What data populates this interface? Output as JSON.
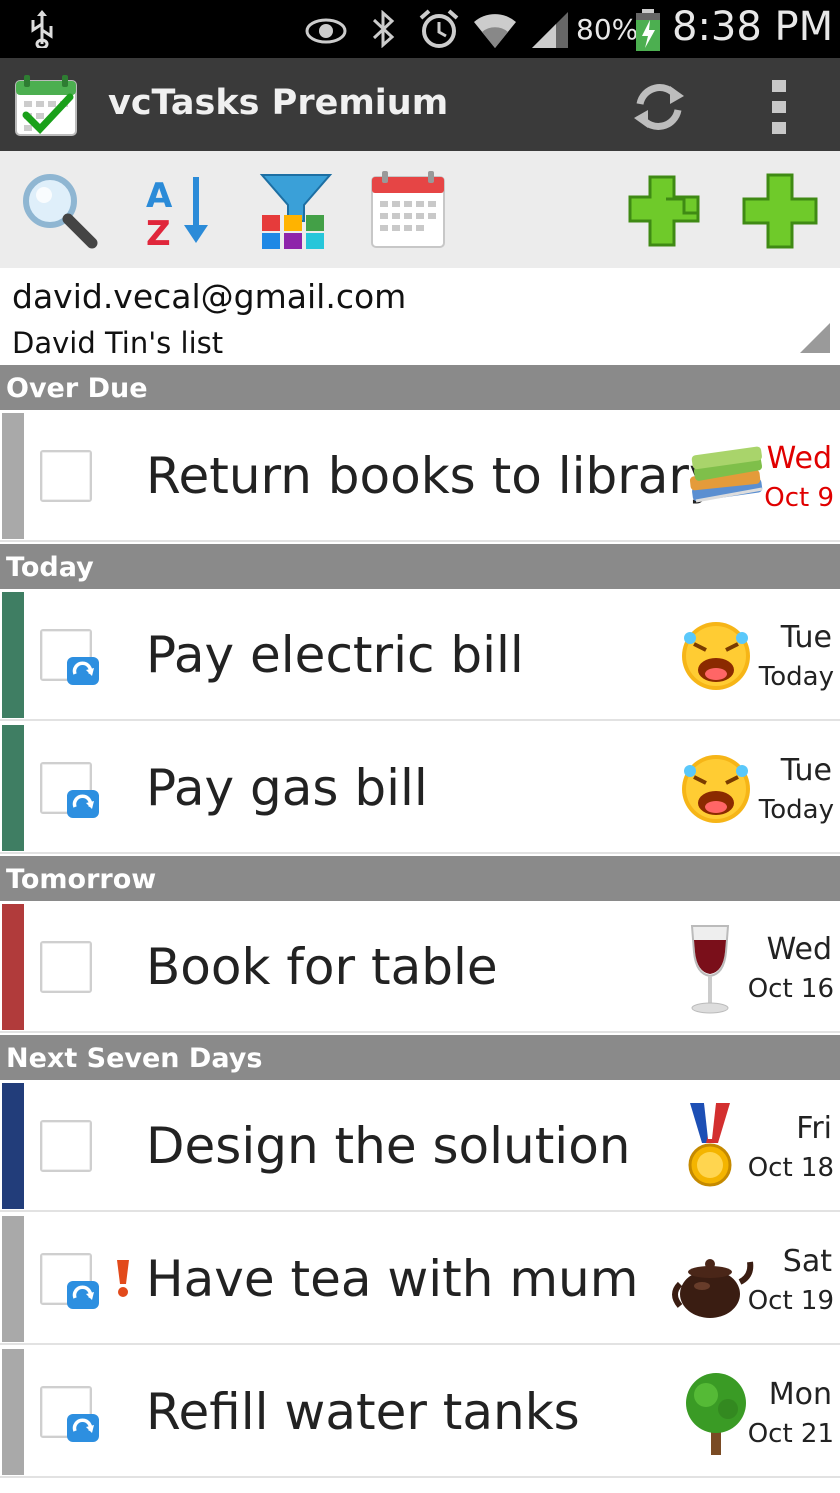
{
  "status_bar": {
    "battery_percent": "80%",
    "time": "8:38 PM",
    "icons": [
      "usb-icon",
      "eye-icon",
      "bluetooth-icon",
      "alarm-icon",
      "wifi-icon",
      "signal-icon",
      "battery-charging-icon"
    ]
  },
  "app": {
    "title": "vcTasks Premium",
    "icons": [
      "app-logo-icon",
      "sync-icon",
      "overflow-menu-icon"
    ]
  },
  "toolbar": {
    "buttons": [
      "search-icon",
      "sort-az-icon",
      "filter-icon",
      "calendar-icon",
      "add-subtask-icon",
      "add-task-icon"
    ]
  },
  "account": {
    "email": "david.vecal@gmail.com",
    "list_name": "David Tin's list"
  },
  "sections": [
    {
      "title": "Over Due",
      "tasks": [
        {
          "title": "Return books to library",
          "day": "Wed",
          "date": "Oct 9",
          "stripe_color": "#a9a9a9",
          "emblem": "books-icon",
          "repeat": false,
          "priority": false,
          "overdue": true
        }
      ]
    },
    {
      "title": "Today",
      "tasks": [
        {
          "title": "Pay electric bill",
          "day": "Tue",
          "date": "Today",
          "stripe_color": "#3f7e63",
          "emblem": "crying-laughing-face-icon",
          "repeat": true,
          "priority": false,
          "overdue": false
        },
        {
          "title": "Pay gas bill",
          "day": "Tue",
          "date": "Today",
          "stripe_color": "#3f7e63",
          "emblem": "crying-laughing-face-icon",
          "repeat": true,
          "priority": false,
          "overdue": false
        }
      ]
    },
    {
      "title": "Tomorrow",
      "tasks": [
        {
          "title": "Book for table",
          "day": "Wed",
          "date": "Oct 16",
          "stripe_color": "#b13b3b",
          "emblem": "wine-glass-icon",
          "repeat": false,
          "priority": false,
          "overdue": false
        }
      ]
    },
    {
      "title": "Next Seven Days",
      "tasks": [
        {
          "title": "Design the solution",
          "day": "Fri",
          "date": "Oct 18",
          "stripe_color": "#223d7a",
          "emblem": "medal-icon",
          "repeat": false,
          "priority": false,
          "overdue": false
        },
        {
          "title": "Have tea with mum",
          "day": "Sat",
          "date": "Oct 19",
          "stripe_color": "#a9a9a9",
          "emblem": "teapot-icon",
          "repeat": true,
          "priority": true,
          "overdue": false
        },
        {
          "title": "Refill water tanks",
          "day": "Mon",
          "date": "Oct 21",
          "stripe_color": "#a9a9a9",
          "emblem": "tree-icon",
          "repeat": true,
          "priority": false,
          "overdue": false
        }
      ]
    }
  ]
}
